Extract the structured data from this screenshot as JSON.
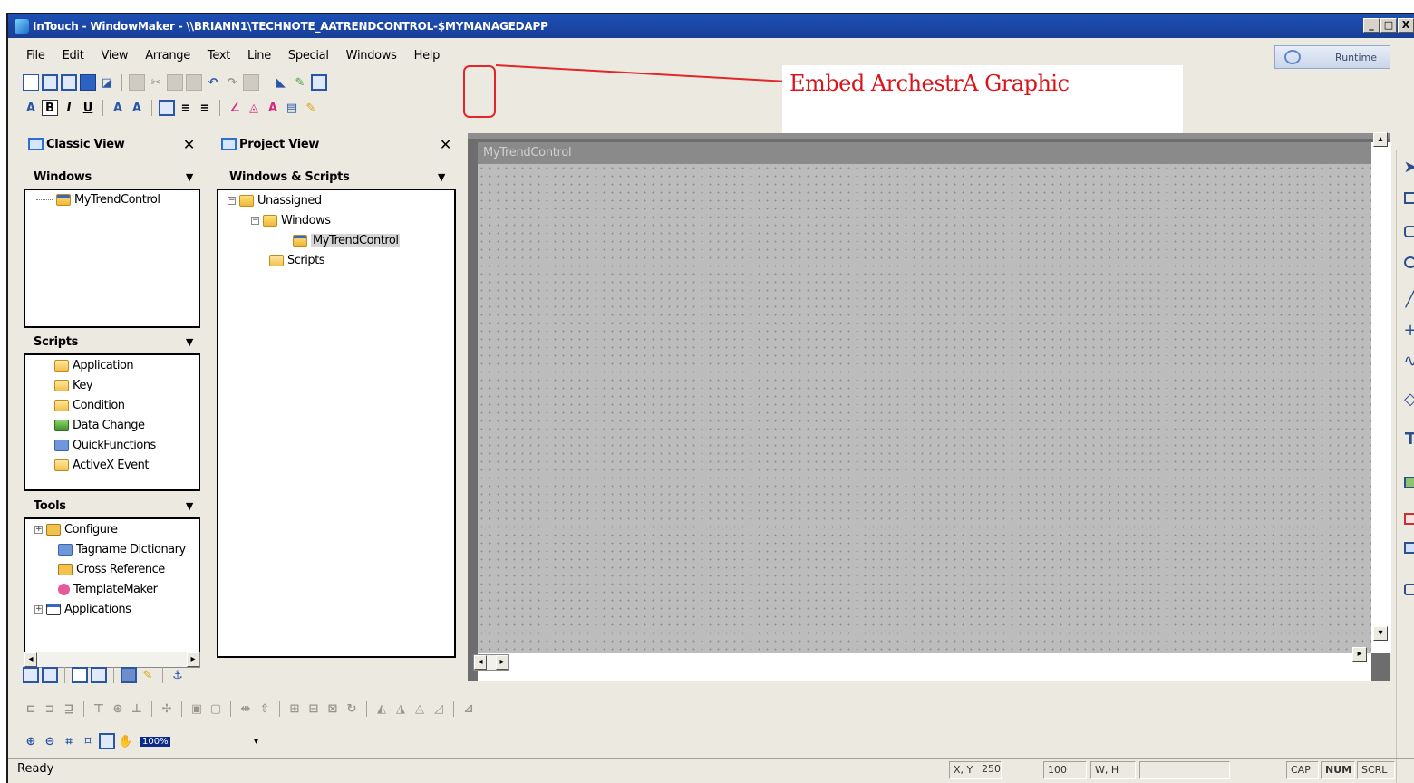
{
  "window": {
    "title": "InTouch - WindowMaker - \\\\BRIANN1\\TECHNOTE_AATRENDCONTROL-$MYMANAGEDAPP",
    "controls": [
      "_",
      "□",
      "X"
    ]
  },
  "menu": [
    "File",
    "Edit",
    "View",
    "Arrange",
    "Text",
    "Line",
    "Special",
    "Windows",
    "Help"
  ],
  "runtime_button": {
    "label": "Runtime",
    "icon": "runtime-icon"
  },
  "callout": {
    "text": "Embed ArchestrA Graphic",
    "color": "#d8151b"
  },
  "classic_view": {
    "title": "Classic View",
    "windows_section": "Windows",
    "windows_items": [
      "MyTrendControl"
    ],
    "scripts_section": "Scripts",
    "scripts_items": [
      "Application",
      "Key",
      "Condition",
      "Data Change",
      "QuickFunctions",
      "ActiveX Event"
    ],
    "tools_section": "Tools",
    "tools_items": [
      "Configure",
      "Tagname Dictionary",
      "Cross Reference",
      "TemplateMaker",
      "Applications"
    ]
  },
  "project_view": {
    "title": "Project View",
    "section": "Windows & Scripts",
    "tree": {
      "root": "Unassigned",
      "windows_folder": "Windows",
      "window_item": "MyTrendControl",
      "scripts_folder": "Scripts"
    }
  },
  "canvas": {
    "window_title": "MyTrendControl"
  },
  "zoom": {
    "value": "100%"
  },
  "status": {
    "ready": "Ready",
    "xy_label": "X, Y",
    "x": "250",
    "y": "100",
    "wh_label": "W, H",
    "indicators": [
      "CAP",
      "NUM",
      "SCRL"
    ]
  },
  "colors": {
    "accent": "#1e4fb4",
    "callout_red": "#e3262a"
  }
}
